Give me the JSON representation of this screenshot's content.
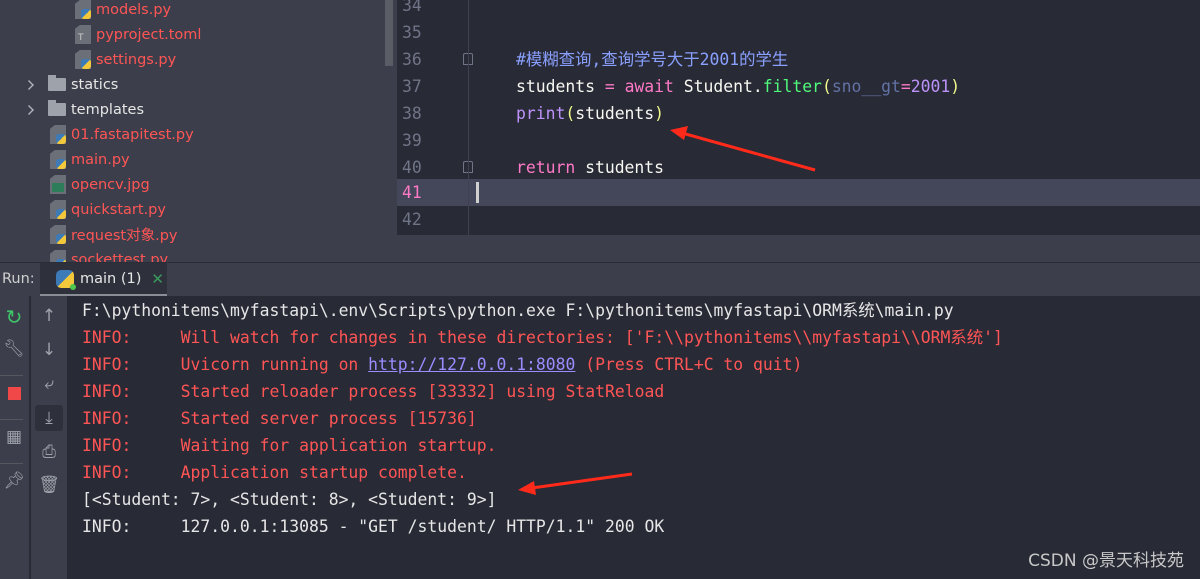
{
  "project_tree": [
    {
      "label": "models.py",
      "type": "py",
      "level": 2,
      "modified": true
    },
    {
      "label": "pyproject.toml",
      "type": "toml",
      "level": 2,
      "modified": true
    },
    {
      "label": "settings.py",
      "type": "py",
      "level": 2,
      "modified": true
    },
    {
      "label": "statics",
      "type": "folder",
      "level": 1,
      "modified": false
    },
    {
      "label": "templates",
      "type": "folder",
      "level": 1,
      "modified": false
    },
    {
      "label": "01.fastapitest.py",
      "type": "py",
      "level": 1,
      "modified": true
    },
    {
      "label": "main.py",
      "type": "py",
      "level": 1,
      "modified": true
    },
    {
      "label": "opencv.jpg",
      "type": "img",
      "level": 1,
      "modified": true
    },
    {
      "label": "quickstart.py",
      "type": "py",
      "level": 1,
      "modified": true
    },
    {
      "label": "request对象.py",
      "type": "py",
      "level": 1,
      "modified": true
    },
    {
      "label": "sockettest.py",
      "type": "py",
      "level": 1,
      "modified": true
    }
  ],
  "editor": {
    "line_numbers": [
      "34",
      "35",
      "36",
      "37",
      "38",
      "39",
      "40",
      "41",
      "42"
    ],
    "current_line": "41",
    "code": {
      "l36": "#模糊查询,查询学号大于2001的学生",
      "l37": {
        "var": "students",
        "eq": " = ",
        "kw": "await",
        "cls": " Student.",
        "fn": "filter",
        "open": "(",
        "arg": "sno__gt",
        "assign": "=",
        "num": "2001",
        "close": ")"
      },
      "l38": {
        "fn": "print",
        "open": "(",
        "arg": "students",
        "close": ")"
      },
      "l40": {
        "kw": "return",
        "rest": " students"
      }
    }
  },
  "run": {
    "label": "Run:",
    "tab_label": "main (1)",
    "output": {
      "cmd": "F:\\pythonitems\\myfastapi\\.env\\Scripts\\python.exe F:\\pythonitems\\myfastapi\\ORM系统\\main.py",
      "l1": "INFO:     Will watch for changes in these directories: ['F:\\\\pythonitems\\\\myfastapi\\\\ORM系统']",
      "l2_pre": "INFO:     Uvicorn running on ",
      "l2_link": "http://127.0.0.1:8080",
      "l2_post": " (Press CTRL+C to quit)",
      "l3": "INFO:     Started reloader process [33332] using StatReload",
      "l4": "INFO:     Started server process [15736]",
      "l5": "INFO:     Waiting for application startup.",
      "l6": "INFO:     Application startup complete.",
      "l7": "[<Student: 7>, <Student: 8>, <Student: 9>]",
      "l8": "INFO:     127.0.0.1:13085 - \"GET /student/ HTTP/1.1\" 200 OK"
    }
  },
  "watermark": "CSDN @景天科技苑",
  "colors": {
    "error": "#ff5555",
    "annotation_arrow": "#ff2a1a",
    "link": "#9d8cff"
  }
}
